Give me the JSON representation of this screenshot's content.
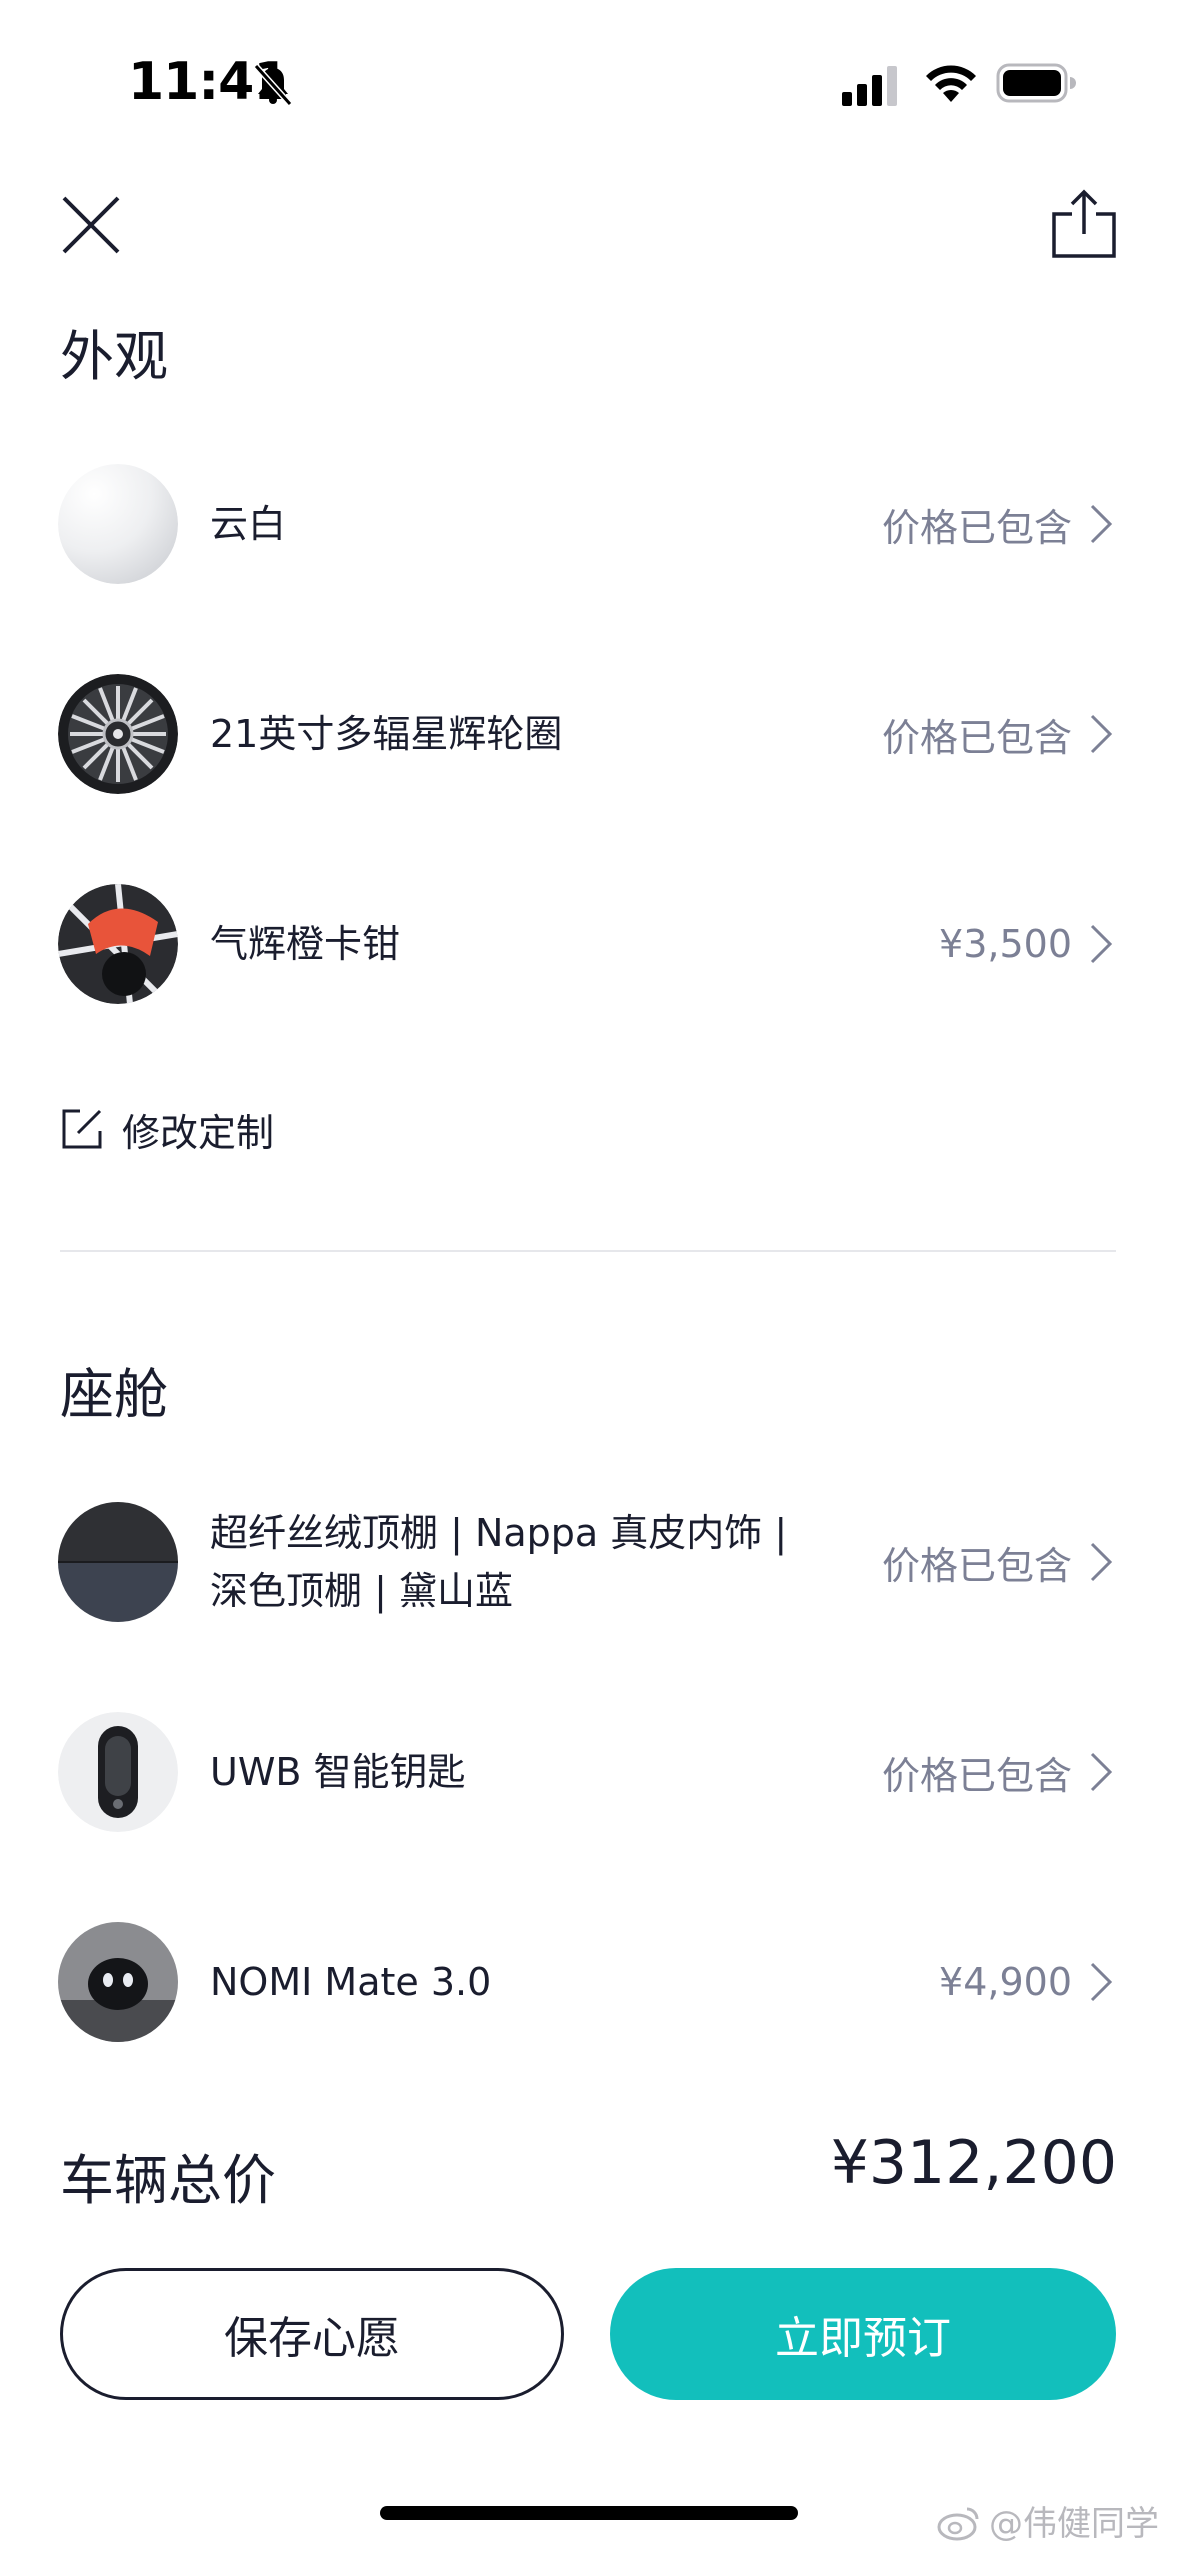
{
  "status_bar": {
    "time": "11:41"
  },
  "exterior": {
    "title": "外观",
    "items": [
      {
        "name": "云白",
        "price": "价格已包含"
      },
      {
        "name": "21英寸多辐星辉轮圈",
        "price": "价格已包含"
      },
      {
        "name": "气辉橙卡钳",
        "price": "¥3,500"
      }
    ],
    "edit_label": "修改定制"
  },
  "cabin": {
    "title": "座舱",
    "items": [
      {
        "name_line1": "超纤丝绒顶棚 | Nappa 真皮内饰 |",
        "name_line2": "深色顶棚 | 黛山蓝",
        "price": "价格已包含"
      },
      {
        "name": "UWB 智能钥匙",
        "price": "价格已包含"
      },
      {
        "name": "NOMI Mate 3.0",
        "price": "¥4,900"
      }
    ]
  },
  "total": {
    "label": "车辆总价",
    "value": "¥312,200"
  },
  "actions": {
    "save_label": "保存心愿",
    "order_label": "立即预订"
  },
  "watermark": "@伟健同学",
  "colors": {
    "accent": "#12bfbc",
    "text": "#1a1d2e",
    "muted": "#7c8095",
    "brake_caliper": "#e8543a"
  }
}
